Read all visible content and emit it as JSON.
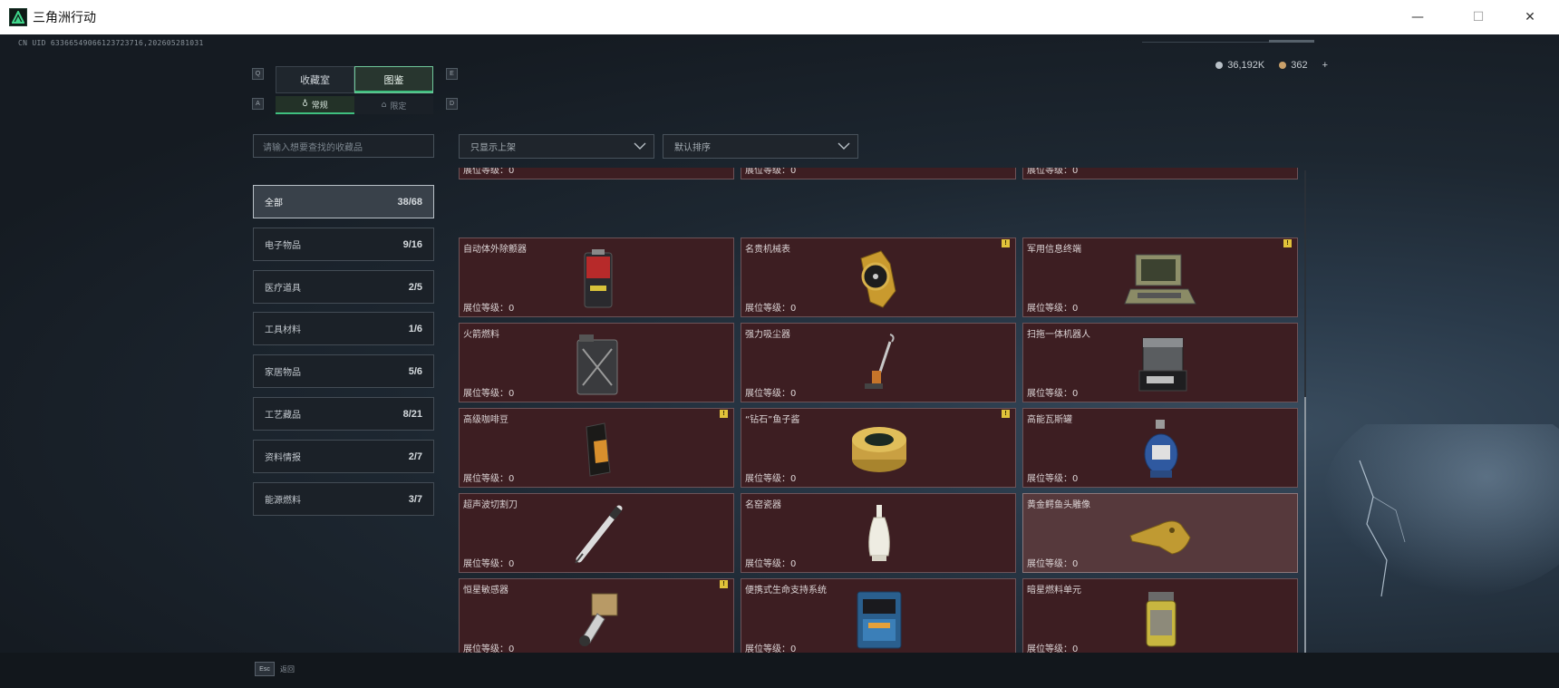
{
  "window": {
    "title": "三角洲行动",
    "minimize": "—",
    "maximize": "☐",
    "close": "✕"
  },
  "uid": "CN UID 63366549066123723716,202605281031",
  "currency": [
    {
      "value": "36,192K",
      "color": "#b9c1c8"
    },
    {
      "value": "362",
      "color": "#c9a06a"
    },
    {
      "value": "+"
    }
  ],
  "keys": {
    "q": "Q",
    "e": "E",
    "a": "A",
    "d": "D",
    "esc": "Esc"
  },
  "tabs": [
    {
      "label": "收藏室"
    },
    {
      "label": "图鉴"
    }
  ],
  "subtabs": [
    {
      "label": "常规"
    },
    {
      "label": "限定"
    }
  ],
  "search": {
    "placeholder": "请输入想要查找的收藏品"
  },
  "filters": [
    {
      "label": "只显示上架"
    },
    {
      "label": "默认排序"
    }
  ],
  "categories": [
    {
      "label": "全部",
      "count": "38/68"
    },
    {
      "label": "电子物品",
      "count": "9/16"
    },
    {
      "label": "医疗道具",
      "count": "2/5"
    },
    {
      "label": "工具材料",
      "count": "1/6"
    },
    {
      "label": "家居物品",
      "count": "5/6"
    },
    {
      "label": "工艺藏品",
      "count": "8/21"
    },
    {
      "label": "资料情报",
      "count": "2/7"
    },
    {
      "label": "能源燃料",
      "count": "3/7"
    }
  ],
  "level_label": "展位等级：",
  "partial_row": [
    {
      "level": "0"
    },
    {
      "level": "0"
    },
    {
      "level": "0"
    }
  ],
  "items": [
    {
      "name": "自动体外除颤器",
      "level": "0",
      "warn": false,
      "icon": "defibrillator-icon"
    },
    {
      "name": "名贵机械表",
      "level": "0",
      "warn": true,
      "icon": "watch-icon"
    },
    {
      "name": "军用信息终端",
      "level": "0",
      "warn": true,
      "icon": "terminal-icon"
    },
    {
      "name": "火箭燃料",
      "level": "0",
      "warn": false,
      "icon": "fuel-can-icon"
    },
    {
      "name": "强力吸尘器",
      "level": "0",
      "warn": false,
      "icon": "vacuum-icon"
    },
    {
      "name": "扫拖一体机器人",
      "level": "0",
      "warn": false,
      "icon": "robot-icon"
    },
    {
      "name": "高级咖啡豆",
      "level": "0",
      "warn": true,
      "icon": "coffee-bag-icon"
    },
    {
      "name": "“钻石”鱼子酱",
      "level": "0",
      "warn": true,
      "icon": "caviar-tin-icon"
    },
    {
      "name": "高能瓦斯罐",
      "level": "0",
      "warn": false,
      "icon": "gas-canister-icon"
    },
    {
      "name": "超声波切割刀",
      "level": "0",
      "warn": false,
      "icon": "cutter-icon"
    },
    {
      "name": "名窑瓷器",
      "level": "0",
      "warn": false,
      "icon": "porcelain-icon"
    },
    {
      "name": "黄金鳄鱼头雕像",
      "level": "0",
      "warn": false,
      "icon": "gold-croc-icon"
    },
    {
      "name": "恒星敏感器",
      "level": "0",
      "warn": true,
      "icon": "star-sensor-icon"
    },
    {
      "name": "便携式生命支持系统",
      "level": "0",
      "warn": false,
      "icon": "life-support-icon"
    },
    {
      "name": "暗星燃料单元",
      "level": "0",
      "warn": false,
      "icon": "fuel-cell-icon"
    }
  ],
  "warn_mark": "!",
  "bottom": {
    "esc_label": "返回"
  }
}
